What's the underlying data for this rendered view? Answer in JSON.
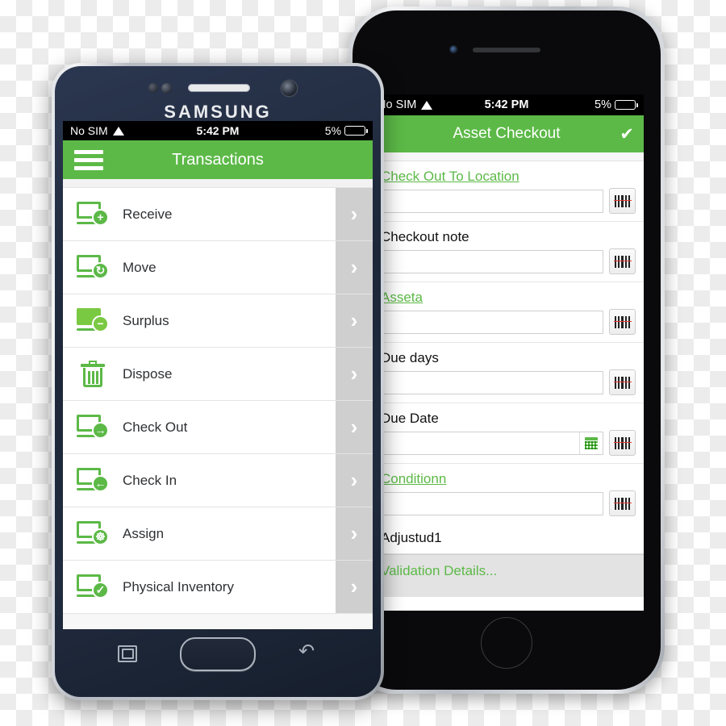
{
  "iphone": {
    "device_name": "iPhone",
    "status_bar": {
      "carrier": "No SIM",
      "wifi_icon": "wifi-icon",
      "time": "5:42 PM",
      "battery_percent": "5%",
      "battery_icon": "battery-icon"
    },
    "navbar": {
      "title": "Asset Checkout",
      "confirm_icon": "✔"
    },
    "form": {
      "fields": [
        {
          "label": "Check Out To Location",
          "is_link": true,
          "value": "",
          "scan_icon": "barcode-scan-icon",
          "calendar": false
        },
        {
          "label": "Checkout note",
          "is_link": false,
          "value": "",
          "scan_icon": "barcode-scan-icon",
          "calendar": false
        },
        {
          "label": "Asseta",
          "is_link": true,
          "value": "",
          "scan_icon": "barcode-scan-icon",
          "calendar": false
        },
        {
          "label": "Due days",
          "is_link": false,
          "value": "",
          "scan_icon": "barcode-scan-icon",
          "calendar": false
        },
        {
          "label": "Due Date",
          "is_link": false,
          "value": "",
          "scan_icon": "barcode-scan-icon",
          "calendar": true,
          "calendar_icon": "calendar-icon"
        }
      ],
      "condition_field": {
        "label": "Conditionn",
        "is_link": true,
        "value": "",
        "scan_icon": "barcode-scan-icon"
      },
      "plain_row": "Adjustud1",
      "validation_link": "Validation Details..."
    }
  },
  "samsung": {
    "device_name": "Samsung",
    "brand": "SAMSUNG",
    "status_bar": {
      "carrier": "No SIM",
      "wifi_icon": "wifi-icon",
      "time": "5:42 PM",
      "battery_percent": "5%",
      "battery_icon": "battery-icon"
    },
    "navbar": {
      "menu_icon": "hamburger-menu-icon",
      "title": "Transactions"
    },
    "transactions": [
      {
        "label": "Receive",
        "icon": "device-plus-icon",
        "badge": "+",
        "chevron": "›"
      },
      {
        "label": "Move",
        "icon": "device-refresh-icon",
        "badge": "↻",
        "chevron": "›"
      },
      {
        "label": "Surplus",
        "icon": "device-minus-icon",
        "badge": "−",
        "chevron": "›"
      },
      {
        "label": "Dispose",
        "icon": "trash-icon",
        "badge": "",
        "chevron": "›"
      },
      {
        "label": "Check Out",
        "icon": "device-arrow-right-icon",
        "badge": "→",
        "chevron": "›"
      },
      {
        "label": "Check In",
        "icon": "device-arrow-left-icon",
        "badge": "←",
        "chevron": "›"
      },
      {
        "label": "Assign",
        "icon": "device-person-icon",
        "badge": "☸",
        "chevron": "›"
      },
      {
        "label": "Physical Inventory",
        "icon": "device-check-icon",
        "badge": "✓",
        "chevron": "›"
      }
    ],
    "nav_buttons": {
      "recent_icon": "recent-apps-icon",
      "home_icon": "home-button",
      "back_icon": "↶"
    }
  },
  "colors": {
    "accent_green": "#5cb947",
    "icon_green": "#7ac943",
    "status_bar": "#000000",
    "chevron_band": "#cfcfcf",
    "laser_red": "#e23b33"
  }
}
